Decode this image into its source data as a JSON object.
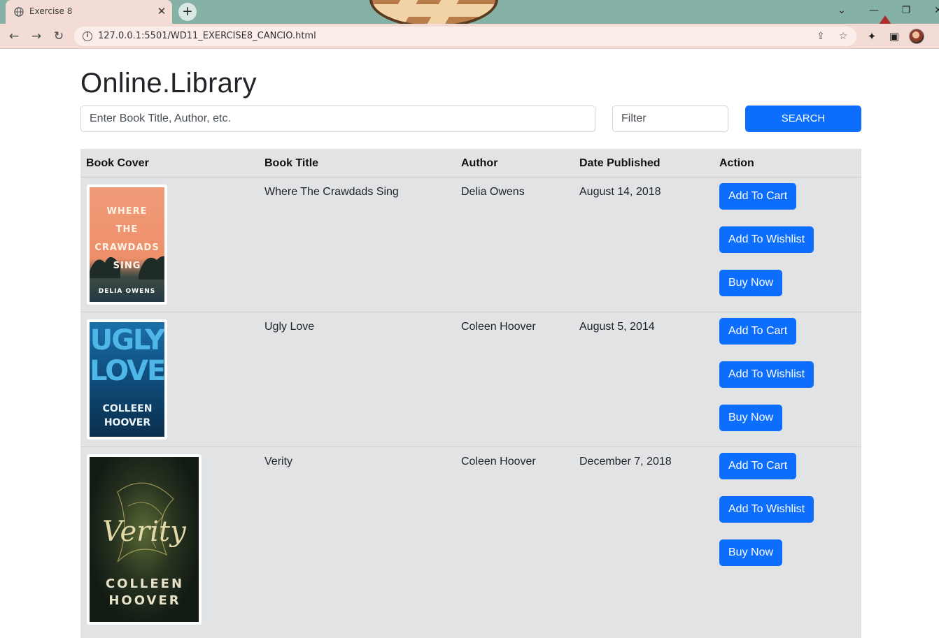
{
  "browser": {
    "tab_title": "Exercise 8",
    "tab_close": "✕",
    "new_tab": "+",
    "url": "127.0.0.1:5501/WD11_EXERCISE8_CANCIO.html",
    "window_controls": {
      "chevron": "⌄",
      "minimize": "—",
      "restore": "❐",
      "close": "✕"
    },
    "nav": {
      "back": "←",
      "forward": "→",
      "reload": "↻"
    },
    "icons": {
      "share": "⇪",
      "bookmark": "☆",
      "extensions": "✦",
      "sidepanel": "▣"
    }
  },
  "page": {
    "title": "Online.Library",
    "search_placeholder": "Enter Book Title, Author, etc.",
    "filter_placeholder": "Filter",
    "search_button": "SEARCH"
  },
  "table": {
    "headers": [
      "Book Cover",
      "Book Title",
      "Author",
      "Date Published",
      "Action"
    ],
    "rows": [
      {
        "title": "Where The Crawdads Sing",
        "author": "Delia Owens",
        "date": "August 14, 2018",
        "cover_lines": [
          "WHERE",
          "THE",
          "CRAWDADS",
          "SING"
        ],
        "cover_author": "DELIA OWENS"
      },
      {
        "title": "Ugly Love",
        "author": "Coleen Hoover",
        "date": "August 5, 2014",
        "cover_lines": [
          "UGLY",
          "LOVE"
        ],
        "cover_author": "COLLEEN HOOVER"
      },
      {
        "title": "Verity",
        "author": "Coleen Hoover",
        "date": "December 7, 2018",
        "cover_lines": [
          "Verity"
        ],
        "cover_author": "COLLEEN HOOVER"
      }
    ],
    "actions": [
      "Add To Cart",
      "Add To Wishlist",
      "Buy Now"
    ]
  },
  "colors": {
    "accent": "#0d6efd",
    "table_bg": "#e2e3e5",
    "tab_strip": "#86b1a6",
    "toolbar": "#f3dcd5"
  }
}
